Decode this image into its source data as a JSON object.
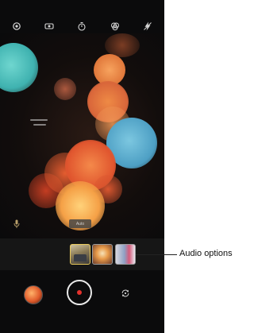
{
  "top_bar": {
    "icons": [
      "settings-icon",
      "aspect-ratio-icon",
      "timer-icon",
      "filter-icon",
      "flash-icon"
    ]
  },
  "viewfinder": {
    "mode_badge": "Auto"
  },
  "thumbnails": {
    "items": [
      "audio-option-thumbnail-1",
      "audio-option-thumbnail-2",
      "audio-option-thumbnail-3"
    ]
  },
  "bottom_bar": {
    "gallery_icon": "gallery-thumbnail",
    "shutter_icon": "record-button",
    "flip_icon": "switch-camera-icon"
  },
  "colors": {
    "record": "#e4312c",
    "selected_thumb_border": "#e8c95b"
  },
  "callout": {
    "label": "Audio options"
  }
}
